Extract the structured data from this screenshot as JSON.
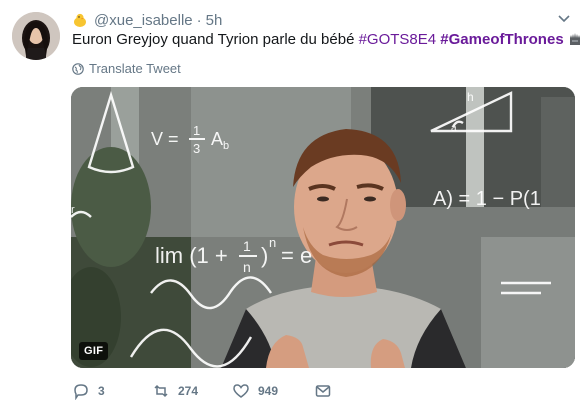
{
  "author": {
    "handle": "@xue_isabelle",
    "time": "5h",
    "separator": "·"
  },
  "tweet": {
    "text": "Euron Greyjoy quand Tyrion parle du bébé ",
    "hashtag1": "#GOTS8E4",
    "hashtag2": "#GameofThrones"
  },
  "translate": {
    "label": "Translate Tweet"
  },
  "media": {
    "badge": "GIF",
    "overlay_formulas": [
      "V = 1/3 A_b",
      "lim (1 + 1/n)^n = e",
      "A) = 1 − P(1",
      "h",
      "a",
      "r"
    ]
  },
  "actions": {
    "replies": "3",
    "retweets": "274",
    "likes": "949"
  },
  "colors": {
    "hashtag": "#6a1b9a",
    "secondary_text": "#657786"
  },
  "icons": [
    "chick-emoji-icon",
    "dropdown-caret-icon",
    "iron-throne-emoji-icon",
    "globe-icon",
    "reply-icon",
    "retweet-icon",
    "like-icon",
    "message-icon"
  ]
}
